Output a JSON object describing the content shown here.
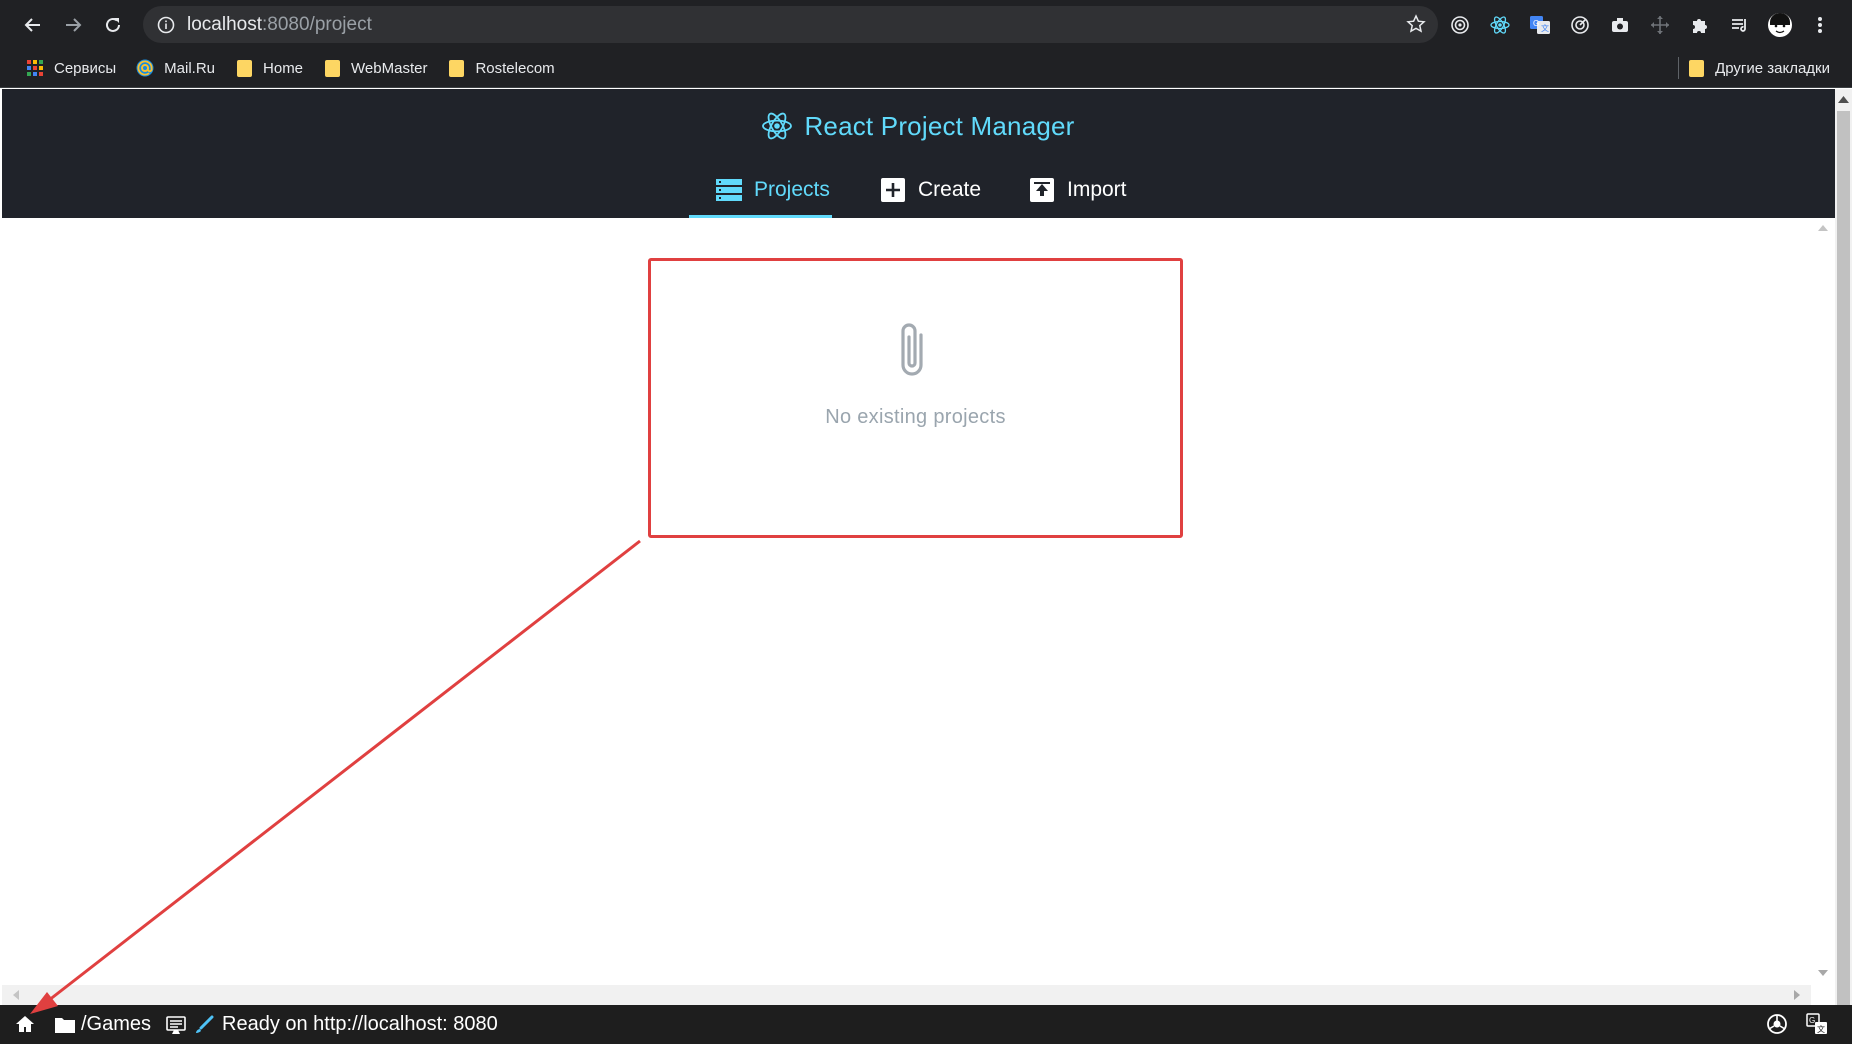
{
  "browser": {
    "url_host": "localhost",
    "url_path": ":8080/project",
    "bookmarks": [
      {
        "label": "Сервисы",
        "icon": "apps-grid-icon"
      },
      {
        "label": "Mail.Ru",
        "icon": "mailru-icon"
      },
      {
        "label": "Home",
        "icon": "folder-icon"
      },
      {
        "label": "WebMaster",
        "icon": "folder-icon"
      },
      {
        "label": "Rostelecom",
        "icon": "folder-icon"
      }
    ],
    "other_bookmarks": "Другие закладки"
  },
  "app": {
    "title": "React Project Manager",
    "tabs": [
      {
        "label": "Projects",
        "icon": "server-list-icon",
        "active": true
      },
      {
        "label": "Create",
        "icon": "plus-box-icon",
        "active": false
      },
      {
        "label": "Import",
        "icon": "upload-box-icon",
        "active": false
      }
    ],
    "empty_message": "No existing projects"
  },
  "statusbar": {
    "folder": "/Games",
    "status": "Ready on http://localhost: 8080"
  },
  "colors": {
    "accent": "#61dafb",
    "header_bg": "#20232a",
    "annotation": "#e04040"
  }
}
